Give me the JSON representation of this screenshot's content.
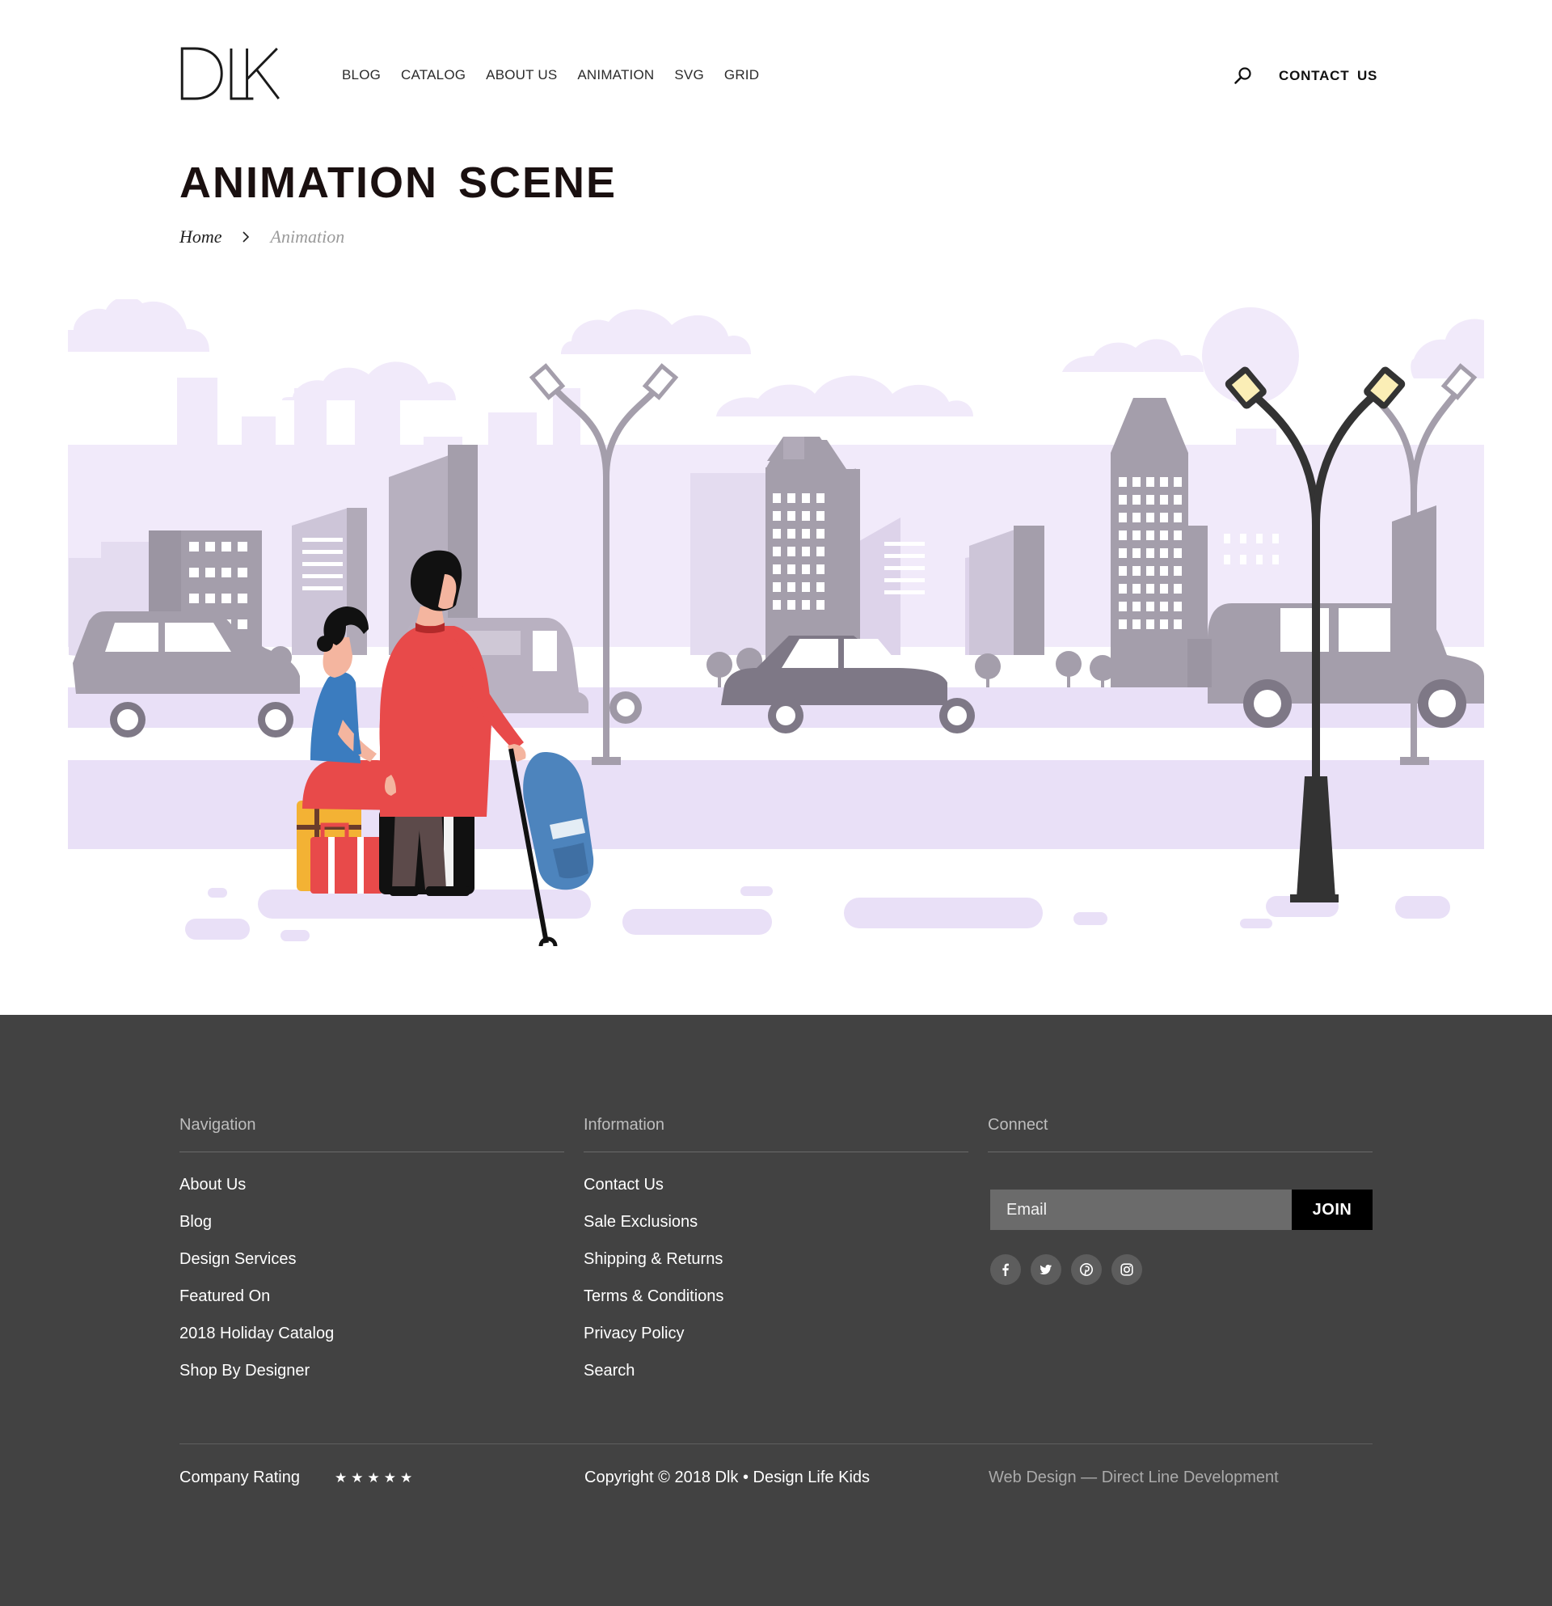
{
  "header": {
    "logo": "DLK",
    "nav": [
      "BLOG",
      "CATALOG",
      "ABOUT US",
      "ANIMATION",
      "SVG",
      "GRID"
    ],
    "search_icon": "search-icon",
    "contact_label": "CONTACT  US"
  },
  "page": {
    "title": "ANIMATION  SCENE",
    "breadcrumb": {
      "home": "Home",
      "current": "Animation"
    }
  },
  "colors": {
    "scene_lavender": "#e9e0f7",
    "scene_light": "#f1eafa",
    "building_gray": "#a49eab",
    "footer_bg": "#424242",
    "man_shirt": "#e84a4a",
    "backpack": "#4d84bd",
    "suitcase_yellow": "#f3b234"
  },
  "footer": {
    "navigation": {
      "title": "Navigation",
      "links": [
        "About Us",
        "Blog",
        "Design Services",
        "Featured On",
        "2018 Holiday Catalog",
        "Shop By Designer"
      ]
    },
    "information": {
      "title": "Information",
      "links": [
        "Contact Us",
        "Sale Exclusions",
        "Shipping & Returns",
        "Terms & Conditions",
        "Privacy Policy",
        "Search"
      ]
    },
    "connect": {
      "title": "Connect",
      "email_placeholder": "Email",
      "join_label": "JOIN",
      "social": [
        "facebook-icon",
        "twitter-icon",
        "pinterest-icon",
        "instagram-icon"
      ]
    },
    "rating_label": "Company Rating",
    "rating": 5,
    "copyright": "Copyright © 2018 Dlk • Design Life Kids",
    "credit": "Web Design — Direct Line Development"
  }
}
